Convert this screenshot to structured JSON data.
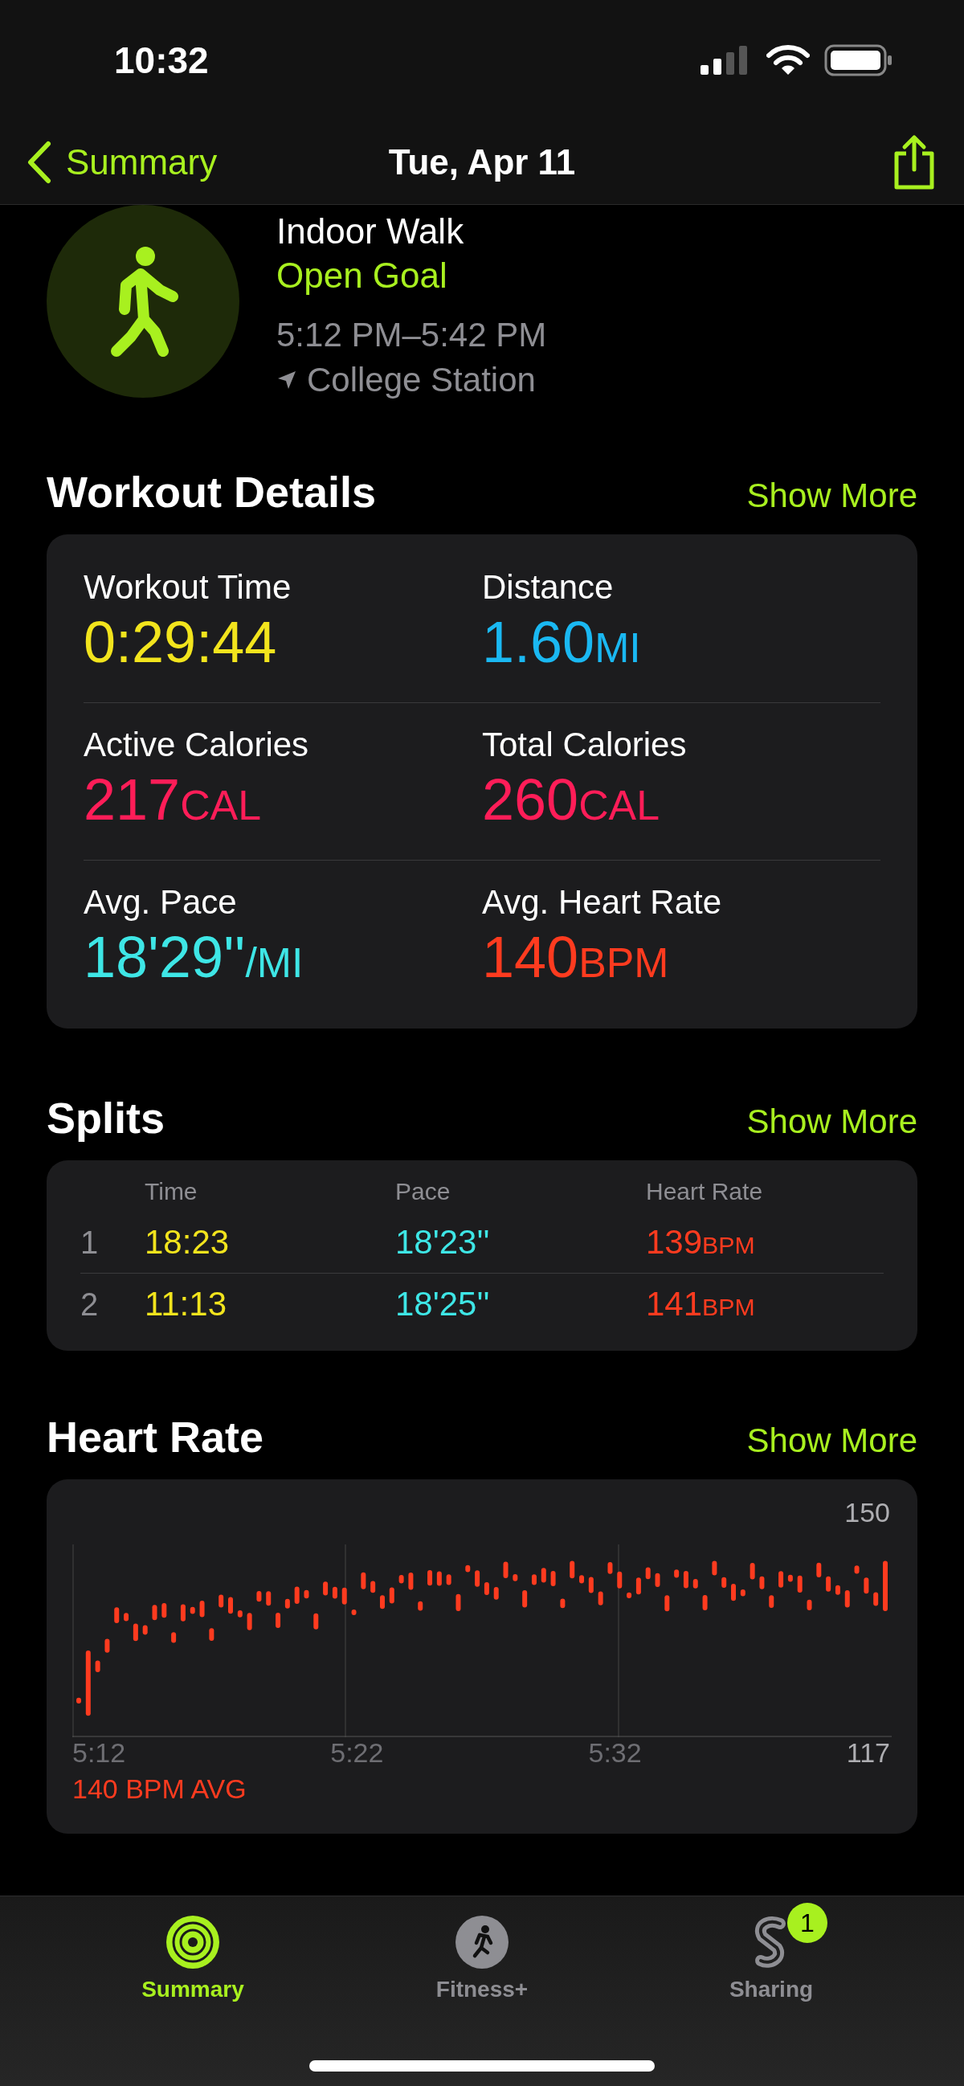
{
  "status_bar": {
    "time": "10:32"
  },
  "nav": {
    "back": "Summary",
    "title": "Tue, Apr 11"
  },
  "workout": {
    "name": "Indoor Walk",
    "goal": "Open Goal",
    "time_range": "5:12 PM–5:42 PM",
    "location": "College Station"
  },
  "details": {
    "title": "Workout Details",
    "more": "Show More",
    "metrics": [
      {
        "label": "Workout Time",
        "value": "0:29:44",
        "color": "#f2e41d"
      },
      {
        "label": "Distance",
        "value": "1.60",
        "unit": "MI",
        "color": "#1ab8f2"
      },
      {
        "label": "Active Calories",
        "value": "217",
        "unit": "CAL",
        "color": "#ff1d58"
      },
      {
        "label": "Total Calories",
        "value": "260",
        "unit": "CAL",
        "color": "#ff1d58"
      },
      {
        "label": "Avg. Pace",
        "value": "18'29''",
        "unit": "/MI",
        "color": "#3ee6e6"
      },
      {
        "label": "Avg. Heart Rate",
        "value": "140",
        "unit": "BPM",
        "color": "#ff3b1f"
      }
    ]
  },
  "splits": {
    "title": "Splits",
    "more": "Show More",
    "columns": [
      "Time",
      "Pace",
      "Heart Rate"
    ],
    "rows": [
      {
        "index": "1",
        "time": "18:23",
        "pace": "18'23''",
        "heart_rate": "139",
        "unit": "BPM"
      },
      {
        "index": "2",
        "time": "11:13",
        "pace": "18'25''",
        "heart_rate": "141",
        "unit": "BPM"
      }
    ]
  },
  "heart_rate": {
    "title": "Heart Rate",
    "more": "Show More",
    "max": "150",
    "min": "117",
    "times": [
      "5:12",
      "5:22",
      "5:32"
    ],
    "average": "140 BPM AVG"
  },
  "tabs": [
    {
      "label": "Summary",
      "selected": true,
      "kind": "rings"
    },
    {
      "label": "Fitness+",
      "selected": false,
      "kind": "runner"
    },
    {
      "label": "Sharing",
      "selected": false,
      "kind": "sharing",
      "badge": "1"
    }
  ]
}
